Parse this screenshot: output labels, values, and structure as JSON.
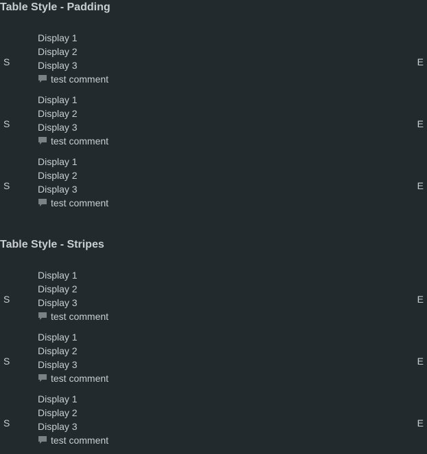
{
  "sections": [
    {
      "title": "Table Style - Padding",
      "rows": [
        {
          "start": "S",
          "end": "E",
          "lines": [
            "Display 1",
            "Display 2",
            "Display 3"
          ],
          "comment": "test comment"
        },
        {
          "start": "S",
          "end": "E",
          "lines": [
            "Display 1",
            "Display 2",
            "Display 3"
          ],
          "comment": "test comment"
        },
        {
          "start": "S",
          "end": "E",
          "lines": [
            "Display 1",
            "Display 2",
            "Display 3"
          ],
          "comment": "test comment"
        }
      ]
    },
    {
      "title": "Table Style - Stripes",
      "rows": [
        {
          "start": "S",
          "end": "E",
          "lines": [
            "Display 1",
            "Display 2",
            "Display 3"
          ],
          "comment": "test comment"
        },
        {
          "start": "S",
          "end": "E",
          "lines": [
            "Display 1",
            "Display 2",
            "Display 3"
          ],
          "comment": "test comment"
        },
        {
          "start": "S",
          "end": "E",
          "lines": [
            "Display 1",
            "Display 2",
            "Display 3"
          ],
          "comment": "test comment"
        }
      ]
    }
  ],
  "icons": {
    "comment": "comment-icon"
  }
}
